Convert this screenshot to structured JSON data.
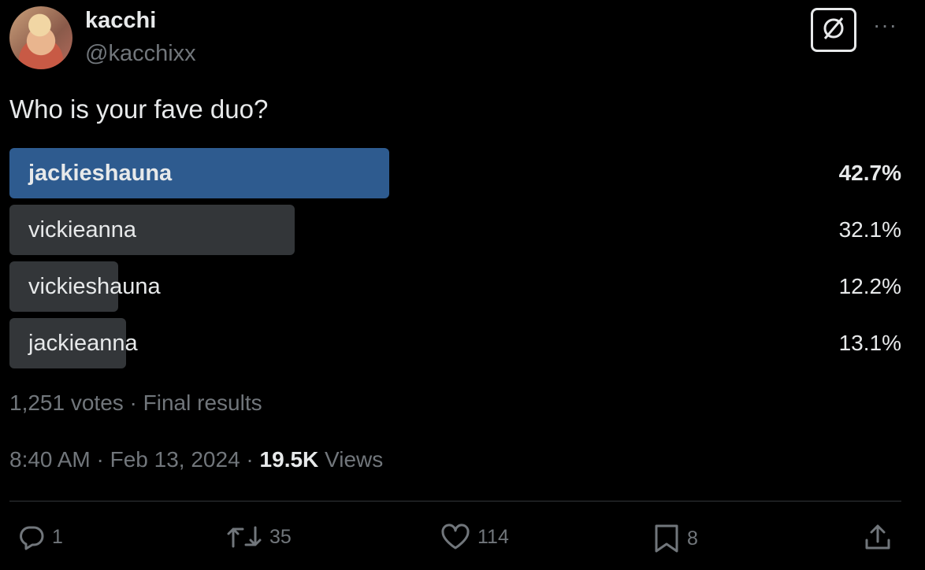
{
  "author": {
    "name": "kacchi",
    "handle": "@kacchixx"
  },
  "tweet": {
    "text": "Who is your fave duo?"
  },
  "poll": {
    "options": [
      {
        "label": "jackieshauna",
        "percent_text": "42.7%",
        "percent": 42.7,
        "winner": true
      },
      {
        "label": "vickieanna",
        "percent_text": "32.1%",
        "percent": 32.1,
        "winner": false
      },
      {
        "label": "vickieshauna",
        "percent_text": "12.2%",
        "percent": 12.2,
        "winner": false
      },
      {
        "label": "jackieanna",
        "percent_text": "13.1%",
        "percent": 13.1,
        "winner": false
      }
    ],
    "meta": "1,251 votes · Final results"
  },
  "timestamp": {
    "time": "8:40 AM",
    "date": "Feb 13, 2024",
    "views_count": "19.5K",
    "views_label": "Views"
  },
  "actions": {
    "replies": "1",
    "reposts": "35",
    "likes": "114",
    "bookmarks": "8"
  },
  "colors": {
    "winner_bar": "#2e5b8f",
    "other_bar": "#333639",
    "muted": "#71767b"
  },
  "icons": [
    "grok-icon",
    "more-icon",
    "reply-icon",
    "repost-icon",
    "like-icon",
    "bookmark-icon",
    "share-icon"
  ]
}
